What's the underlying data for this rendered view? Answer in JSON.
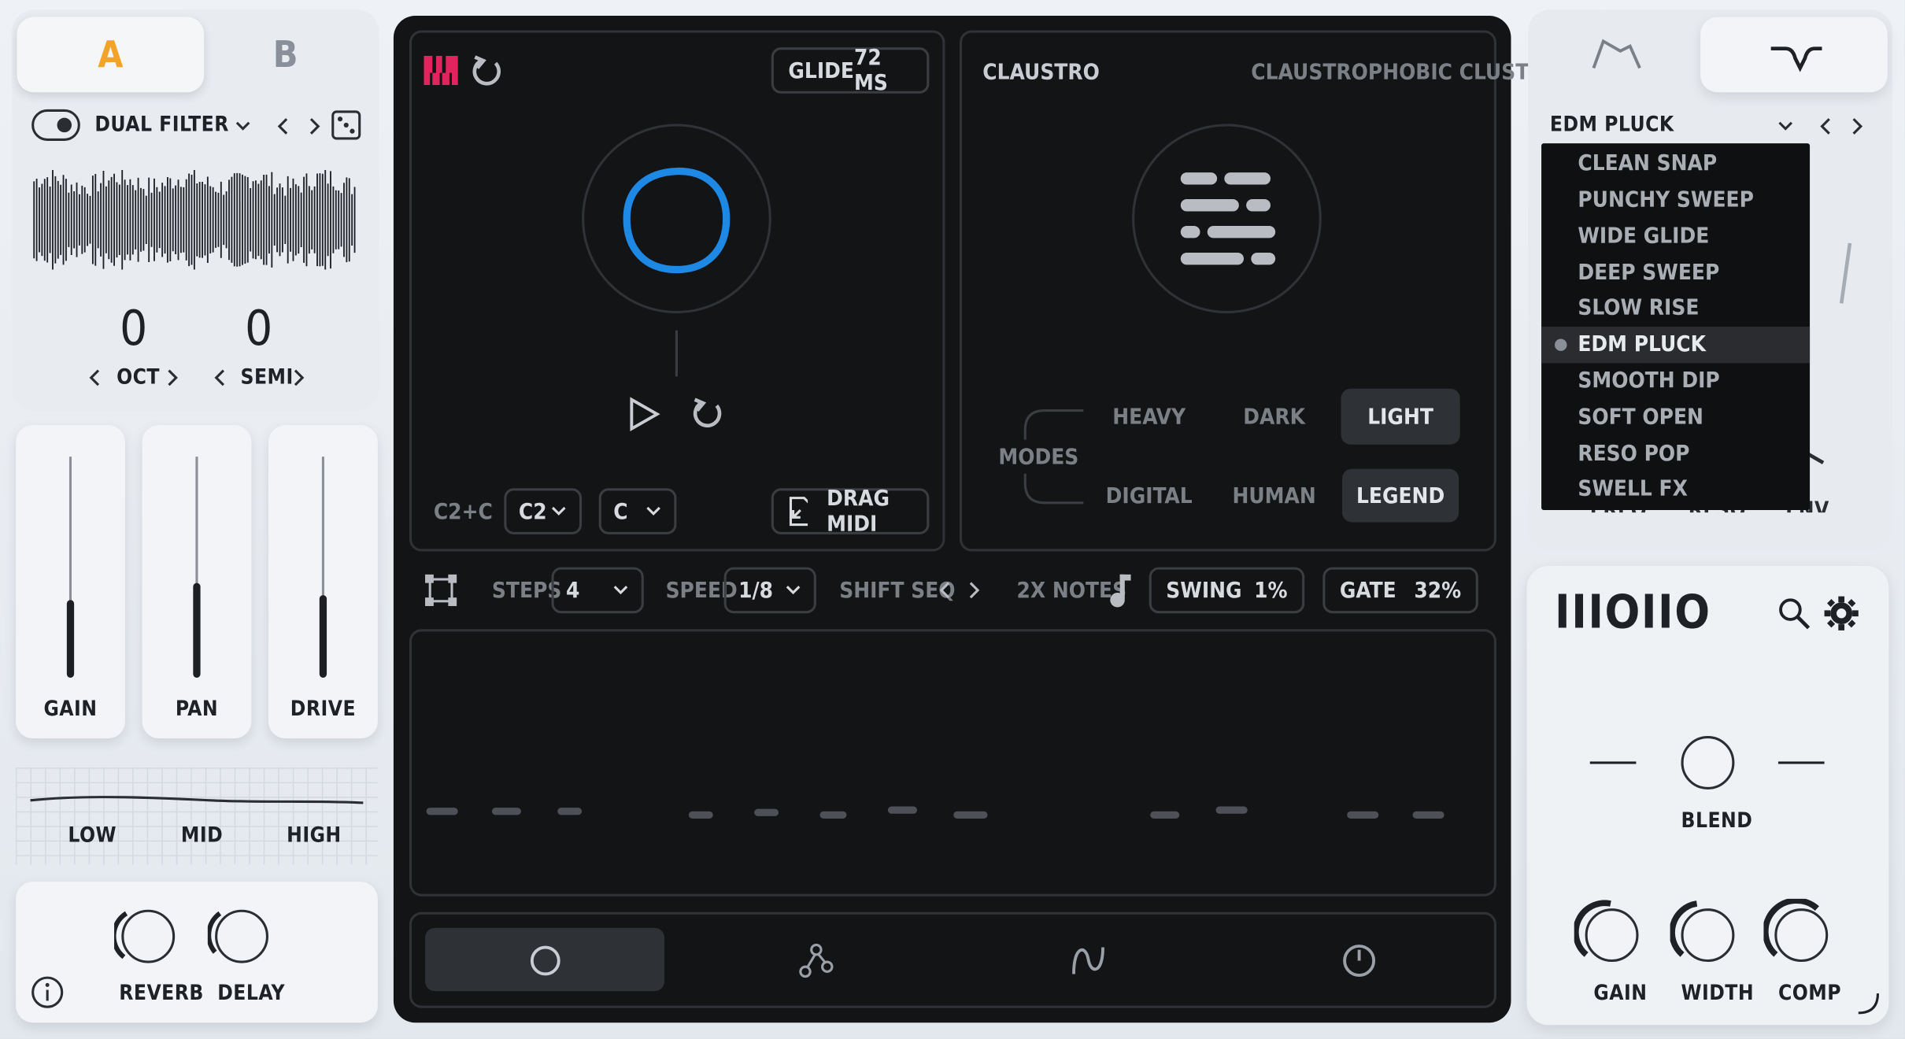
{
  "tabs": {
    "a": "A",
    "b": "B"
  },
  "left": {
    "filter_label": "DUAL FILTER",
    "oct_value": "0",
    "semi_value": "0",
    "oct_label": "OCT",
    "semi_label": "SEMI",
    "faders": [
      {
        "label": "GAIN",
        "level": 0.35
      },
      {
        "label": "PAN",
        "level": 0.42
      },
      {
        "label": "DRIVE",
        "level": 0.36
      }
    ],
    "eq": {
      "low": "LOW",
      "mid": "MID",
      "high": "HIGH"
    },
    "fx": {
      "reverb": "REVERB",
      "delay": "DELAY"
    }
  },
  "sequencer": {
    "glide_label": "GLIDE",
    "glide_value": "72 MS",
    "range_label": "C2+C",
    "octave_select": "C2",
    "key_select": "C",
    "drag_midi": "DRAG MIDI",
    "preset_name": "CLAUSTRO",
    "preset_desc": "CLAUSTROPHOBIC CLUSTER",
    "modes_label": "MODES",
    "modes": [
      {
        "label": "HEAVY",
        "active": false
      },
      {
        "label": "DARK",
        "active": false
      },
      {
        "label": "LIGHT",
        "active": true
      },
      {
        "label": "DIGITAL",
        "active": false
      },
      {
        "label": "HUMAN",
        "active": false
      },
      {
        "label": "LEGEND",
        "active": true
      }
    ],
    "steps_label": "STEPS",
    "steps_value": "4",
    "speed_label": "SPEED",
    "speed_value": "1/8",
    "shift_label": "SHIFT SEQ",
    "twox_label": "2X NOTES",
    "swing_label": "SWING",
    "swing_value": "1%",
    "gate_label": "GATE",
    "gate_value": "32%"
  },
  "right": {
    "preset_select": "EDM PLUCK",
    "dropdown_items": [
      "CLEAN SNAP",
      "PUNCHY SWEEP",
      "WIDE GLIDE",
      "DEEP SWEEP",
      "SLOW RISE",
      "EDM PLUCK",
      "SMOOTH DIP",
      "SOFT OPEN",
      "RESO POP",
      "SWELL FX"
    ],
    "dropdown_selected_index": 5,
    "partial_labels": {
      "freq": "FREQ",
      "reso": "RESO",
      "env": "ENV"
    },
    "logo": "IIIOIIO",
    "blend_label": "BLEND",
    "knobs": {
      "gain": "GAIN",
      "width": "WIDTH",
      "comp": "COMP"
    }
  },
  "colors": {
    "accent_orange": "#f2a42a",
    "accent_blue": "#1e88e5",
    "midi_pink": "#e0245e"
  }
}
